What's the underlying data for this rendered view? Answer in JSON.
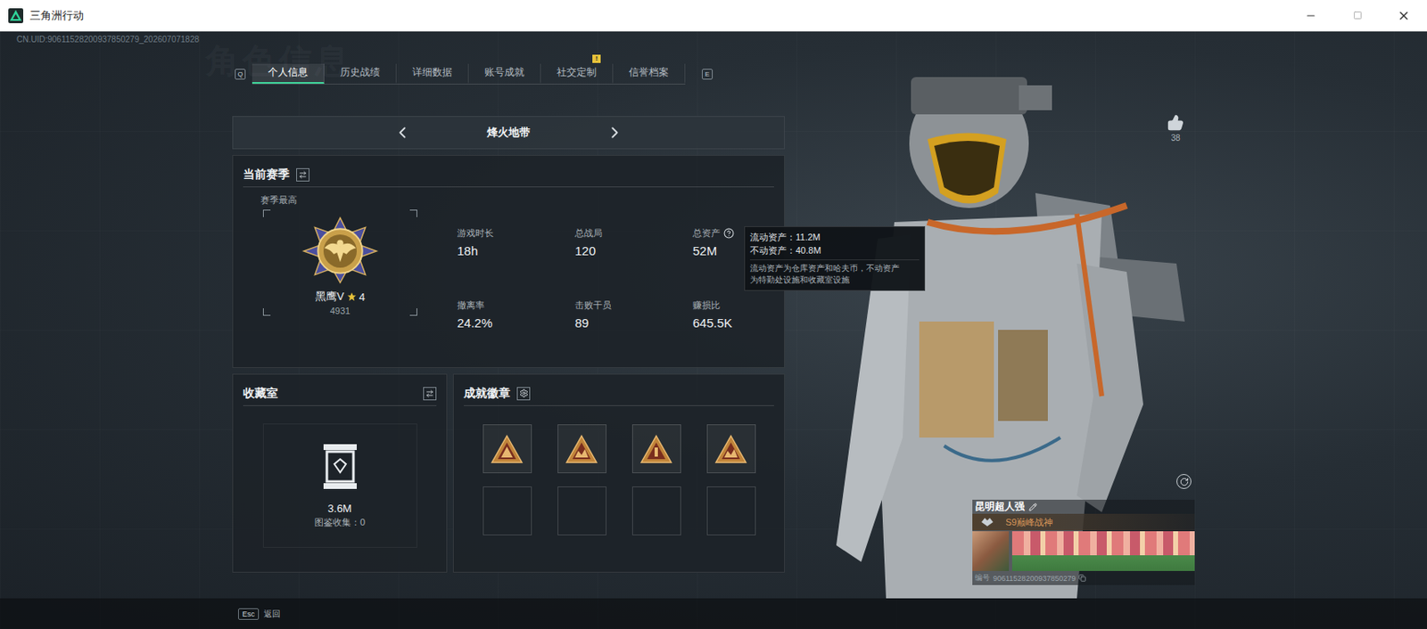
{
  "window": {
    "title": "三角洲行动"
  },
  "uid": "CN.UID:90611528200937850279_202607071828",
  "watermark": "角色信息",
  "tabs": {
    "prev_key": "Q",
    "next_key": "E",
    "items": [
      {
        "label": "个人信息",
        "selected": true,
        "badge": ""
      },
      {
        "label": "历史战绩",
        "selected": false,
        "badge": ""
      },
      {
        "label": "详细数据",
        "selected": false,
        "badge": ""
      },
      {
        "label": "账号成就",
        "selected": false,
        "badge": ""
      },
      {
        "label": "社交定制",
        "selected": false,
        "badge": "!"
      },
      {
        "label": "信誉档案",
        "selected": false,
        "badge": ""
      }
    ]
  },
  "mode": {
    "label": "烽火地带"
  },
  "season": {
    "title": "当前赛季",
    "peak_label": "赛季最高",
    "rank": "黑鹰V",
    "stars": "4",
    "score": "4931",
    "stats": [
      {
        "label": "游戏时长",
        "value": "18h",
        "help": false
      },
      {
        "label": "总战局",
        "value": "120",
        "help": false
      },
      {
        "label": "总资产",
        "value": "52M",
        "help": true
      },
      {
        "label": "撤离率",
        "value": "24.2%",
        "help": false
      },
      {
        "label": "击败干员",
        "value": "89",
        "help": false
      },
      {
        "label": "赚损比",
        "value": "645.5K",
        "help": false
      }
    ]
  },
  "tooltip": {
    "lines": [
      "流动资产：11.2M",
      "不动资产：40.8M"
    ],
    "note": [
      "流动资产为仓库资产和哈夫币，不动资产",
      "为特勤处设施和收藏室设施"
    ]
  },
  "collection": {
    "title": "收藏室",
    "value": "3.6M",
    "caption": "图鉴收集：0"
  },
  "achievements": {
    "title": "成就徽章",
    "slots": [
      {
        "filled": true
      },
      {
        "filled": true
      },
      {
        "filled": true
      },
      {
        "filled": true
      },
      {
        "filled": false
      },
      {
        "filled": false
      },
      {
        "filled": false
      },
      {
        "filled": false
      }
    ]
  },
  "likes": "38",
  "card": {
    "name": "昆明超人强",
    "title": "S9巅峰战神",
    "id_label": "编号",
    "id": "90611528200937850279"
  },
  "footer": {
    "key": "Esc",
    "label": "返回"
  }
}
